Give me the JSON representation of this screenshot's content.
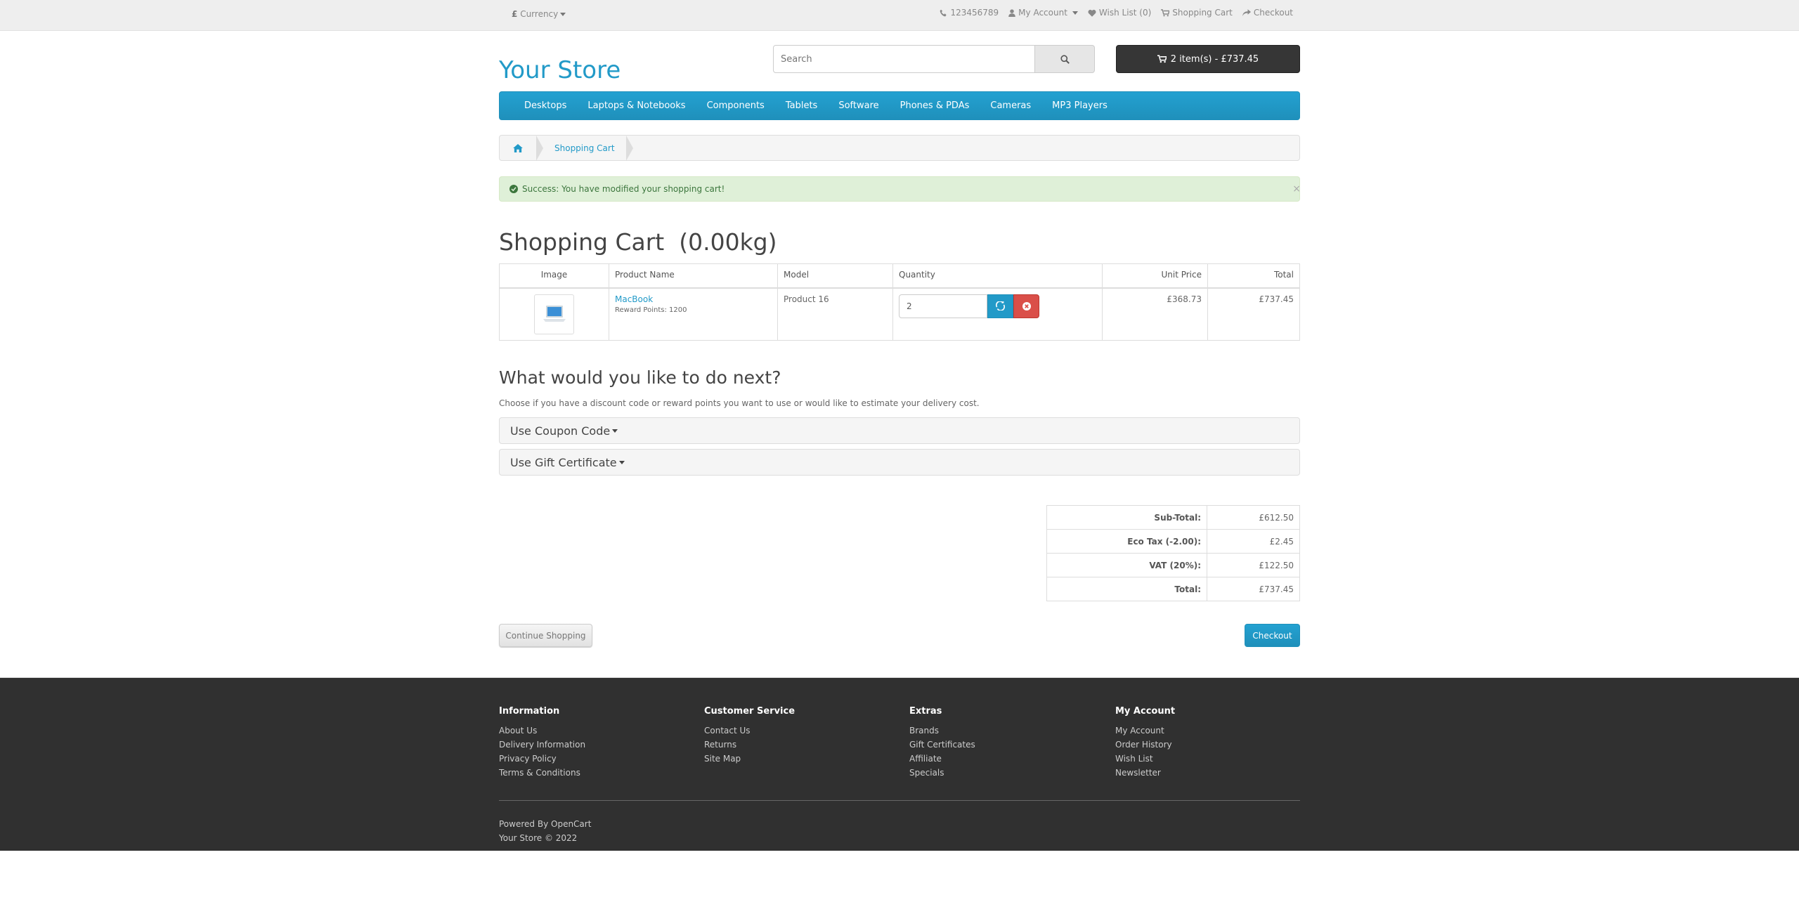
{
  "topbar": {
    "currency_label": "Currency",
    "currency_symbol": "£",
    "phone": "123456789",
    "my_account": "My Account",
    "wishlist": "Wish List (0)",
    "shopping_cart": "Shopping Cart",
    "checkout": "Checkout"
  },
  "header": {
    "logo": "Your Store",
    "search_placeholder": "Search",
    "cart_button": "2 item(s) - £737.45"
  },
  "menu": {
    "items": [
      "Desktops",
      "Laptops & Notebooks",
      "Components",
      "Tablets",
      "Software",
      "Phones & PDAs",
      "Cameras",
      "MP3 Players"
    ]
  },
  "breadcrumb": {
    "current": "Shopping Cart"
  },
  "alert": {
    "message": "Success: You have modified your shopping cart!",
    "close": "×"
  },
  "page": {
    "title": "Shopping Cart  (0.00kg)"
  },
  "cart_table": {
    "headers": [
      "Image",
      "Product Name",
      "Model",
      "Quantity",
      "Unit Price",
      "Total"
    ],
    "rows": [
      {
        "name": "MacBook",
        "reward": "Reward Points: 1200",
        "model": "Product 16",
        "quantity": "2",
        "unit_price": "£368.73",
        "total": "£737.45"
      }
    ]
  },
  "next": {
    "title": "What would you like to do next?",
    "description": "Choose if you have a discount code or reward points you want to use or would like to estimate your delivery cost.",
    "coupon": "Use Coupon Code",
    "gift": "Use Gift Certificate"
  },
  "totals": [
    {
      "label": "Sub-Total:",
      "value": "£612.50"
    },
    {
      "label": "Eco Tax (-2.00):",
      "value": "£2.45"
    },
    {
      "label": "VAT (20%):",
      "value": "£122.50"
    },
    {
      "label": "Total:",
      "value": "£737.45"
    }
  ],
  "actions": {
    "continue": "Continue Shopping",
    "checkout": "Checkout"
  },
  "footer": {
    "columns": [
      {
        "title": "Information",
        "links": [
          "About Us",
          "Delivery Information",
          "Privacy Policy",
          "Terms & Conditions"
        ]
      },
      {
        "title": "Customer Service",
        "links": [
          "Contact Us",
          "Returns",
          "Site Map"
        ]
      },
      {
        "title": "Extras",
        "links": [
          "Brands",
          "Gift Certificates",
          "Affiliate",
          "Specials"
        ]
      },
      {
        "title": "My Account",
        "links": [
          "My Account",
          "Order History",
          "Wish List",
          "Newsletter"
        ]
      }
    ],
    "powered_prefix": "Powered By",
    "powered_link": "OpenCart",
    "copyright": "Your Store © 2022"
  },
  "colors": {
    "accent": "#229ac8",
    "dark": "#303030",
    "success_bg": "#dff0d8",
    "danger": "#da4f49"
  }
}
